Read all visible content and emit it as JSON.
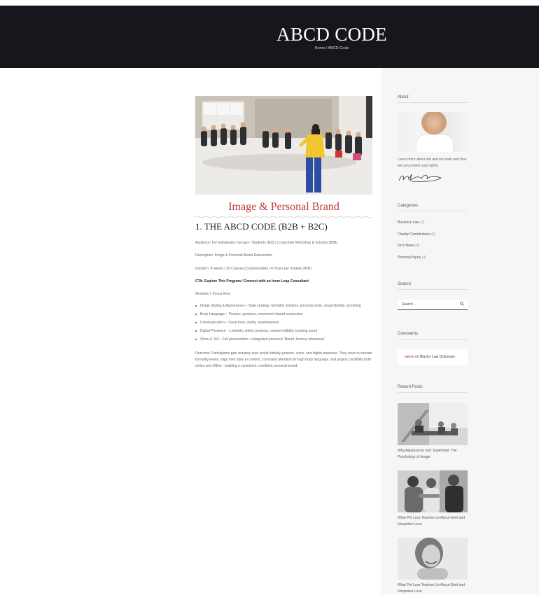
{
  "hero": {
    "title": "ABCD CODE",
    "breadcrumb_home": "Home",
    "breadcrumb_separator": " / ",
    "breadcrumb_current": "ABCD Code"
  },
  "article": {
    "accent_heading": "Image & Personal Brand",
    "section_heading": "1. THE ABCD CODE (B2B + B2C)",
    "audience": "Audience: For Individuals / Groups / Students (B2C) | Corporate Workshop & Schools (B2B)",
    "description": "Description: Image & Personal Brand Reinvention",
    "duration": "Duration: 8 weeks / 16 Classes (Customizable) | 4 Hours per module (B2B)",
    "cta": "CTA: Explore This Program / Connect with an Inner Leap Consultant",
    "modules_label": "Modules + Focus Area",
    "modules": [
      "Image Styling & Appearance – Style strategy, formality systems, personal style, visual identity, grooming",
      "Body Language – Posture, gestures, movement-based expression",
      "Communication – Vocal tone, clarity, assertiveness",
      "Digital Presence – LinkedIn, online persona, content visibility (coming soon)",
      "Show & Tell – Full presentation + integrated presence 'Brand Journey showcase'"
    ],
    "outcome": "Outcome: Participants gain mastery over visual identity, posture, voice, and digital presence. They learn to decode formality levels, align their style to context, command attention through body language, and project credibility both online and offline - building a consistent, confident personal brand."
  },
  "sidebar": {
    "about": {
      "title": "About",
      "text": "Learn more about me and my team and how we can protect your rights."
    },
    "categories": {
      "title": "Categories",
      "items": [
        {
          "label": "Business Law",
          "count": "(3)"
        },
        {
          "label": "Charity Contributions",
          "count": "(4)"
        },
        {
          "label": "Firm News",
          "count": "(4)"
        },
        {
          "label": "Personal Injury",
          "count": "(4)"
        }
      ]
    },
    "search": {
      "title": "Search",
      "placeholder": "Search ..."
    },
    "comments": {
      "title": "Comments",
      "author": "admin",
      "on": " on ",
      "post": "Black's Law Dictionary"
    },
    "recent_posts": {
      "title": "Recent Posts",
      "items": [
        {
          "title": "Why Appearance Isn't Superficial: The Psychology of Image"
        },
        {
          "title": "What Pet Loss Teaches Us About Grief and Unspoken Love"
        },
        {
          "title": "What Pet Loss Teaches Us About Grief and Unspoken Love"
        }
      ]
    }
  },
  "colors": {
    "hero_bg": "#16161c",
    "accent": "#c0393a",
    "sidebar_bg": "#f6f6f6"
  }
}
